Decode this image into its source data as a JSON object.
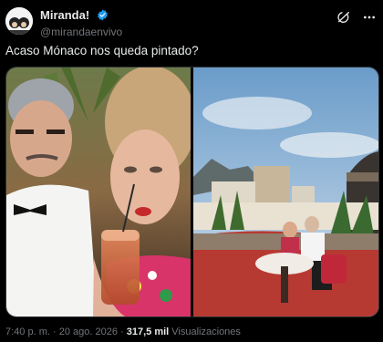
{
  "author": {
    "display_name": "Miranda!",
    "handle": "@mirandaenvivo",
    "verified": true
  },
  "header_actions": [
    "grok-icon",
    "more-icon"
  ],
  "post": {
    "text": "Acaso Mónaco nos queda pintado?"
  },
  "media": {
    "photo_count": 2
  },
  "meta": {
    "time": "7:40 p. m.",
    "separator": "·",
    "date": "20 ago. 2026",
    "views_count": "317,5 mil",
    "views_label": "Visualizaciones"
  }
}
